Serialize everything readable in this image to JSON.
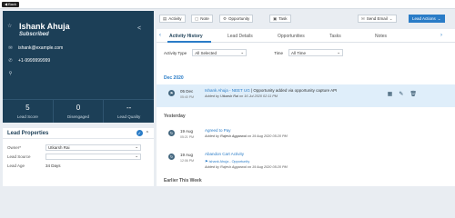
{
  "topbar": {
    "back_label": "Back"
  },
  "lead": {
    "name": "Ishank Ahuja",
    "status": "Subscribed",
    "email": "ishank@example.com",
    "phone": "+1-9999999999",
    "metrics": [
      {
        "value": "5",
        "label": "Lead Score"
      },
      {
        "value": "0",
        "label": "Disengaged"
      },
      {
        "value": "--",
        "label": "Lead Quality"
      }
    ]
  },
  "lead_properties": {
    "title": "Lead Properties",
    "owner_label": "Owner*",
    "owner_value": "Utkarsh Rai",
    "source_label": "Lead Source",
    "source_value": "",
    "age_label": "Lead Age",
    "age_value": "34 Days"
  },
  "toolbar": {
    "activity": "Activity",
    "note": "Note",
    "opportunity": "Opportunity",
    "task": "Task",
    "send_email": "Send Email",
    "lead_actions": "Lead Actions"
  },
  "tabs": [
    {
      "label": "Activity History"
    },
    {
      "label": "Lead Details"
    },
    {
      "label": "Opportunities"
    },
    {
      "label": "Tasks"
    },
    {
      "label": "Notes"
    }
  ],
  "filters": {
    "activity_type_label": "Activity Type",
    "activity_type_value": "All Selected",
    "time_label": "Time",
    "time_value": "All Time"
  },
  "sections": {
    "dec": "Dec 2020",
    "yesterday": "Yesterday",
    "earlier": "Earlier This Week"
  },
  "activities": [
    {
      "date": "05 Dec",
      "time": "05:40 PM",
      "title": "Ishank Ahuja - NEET UG",
      "separator": " | ",
      "description": "Opportunity added via opportunity capture API",
      "added_prefix": "Added by",
      "added_by": "Utkarsh Rai",
      "added_on": "on 16 Jul 2020 02:11 PM"
    },
    {
      "date": "19 Aug",
      "time": "05:21 PM",
      "title": "Agreed to Pay",
      "added_prefix": "Added by",
      "added_by": "Rajesh Aggarwal",
      "added_on": "on 19 Aug 2020 05:20 PM"
    },
    {
      "date": "19 Aug",
      "time": "12:06 PM",
      "title": "Abandon Cart Activity",
      "link": "Ishank Ahuja - Opportunity",
      "added_prefix": "Added by",
      "added_by": "Rajesh Aggarwal",
      "added_on": "on 19 Aug 2020 05:20 PM"
    }
  ]
}
